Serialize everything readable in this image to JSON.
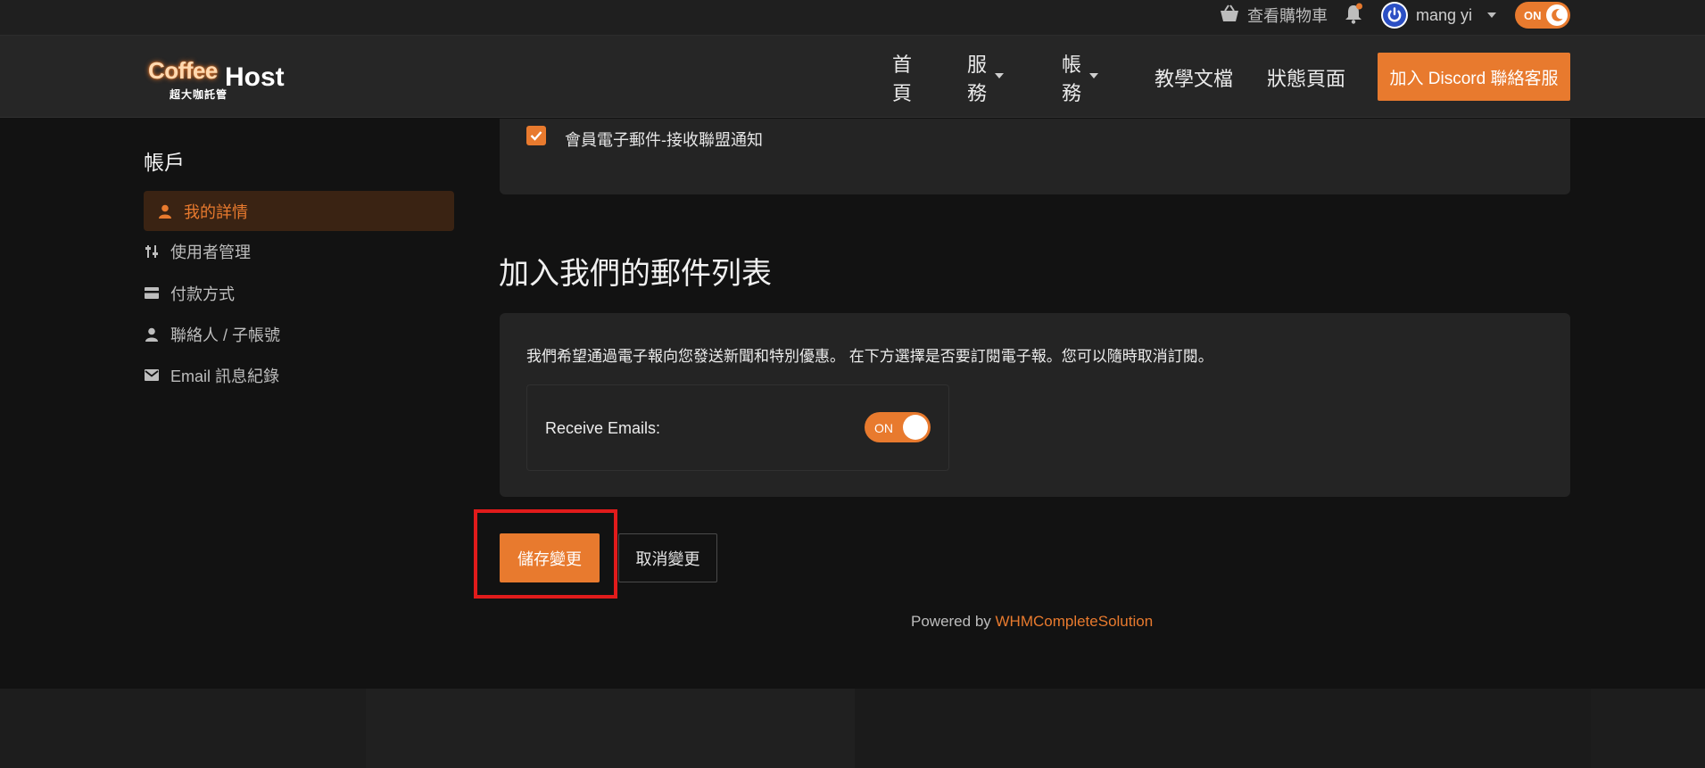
{
  "colors": {
    "accent": "#e87a2e",
    "page_bg": "#121212",
    "card_bg": "#242424",
    "highlight_box": "#e11b1b"
  },
  "topbar": {
    "cart_label": "查看購物車",
    "cart_icon": "basket-icon",
    "bell_icon": "bell-icon",
    "username": "mang yi",
    "theme_toggle_label": "ON",
    "theme_toggle_icon": "moon-icon"
  },
  "navbar": {
    "logo_primary": "Coffee",
    "logo_secondary": "Host",
    "logo_sub": "超大咖託管",
    "links": [
      {
        "label": "首頁",
        "has_dropdown": false
      },
      {
        "label": "服務",
        "has_dropdown": true
      },
      {
        "label": "帳務",
        "has_dropdown": true
      },
      {
        "label": "教學文檔",
        "has_dropdown": false
      },
      {
        "label": "狀態頁面",
        "has_dropdown": false
      }
    ],
    "discord_button": "加入 Discord 聯絡客服"
  },
  "sidebar": {
    "title": "帳戶",
    "items": [
      {
        "label": "我的詳情",
        "icon": "user-icon",
        "active": true
      },
      {
        "label": "使用者管理",
        "icon": "sliders-icon",
        "active": false
      },
      {
        "label": "付款方式",
        "icon": "credit-card-icon",
        "active": false
      },
      {
        "label": "聯絡人 / 子帳號",
        "icon": "user-icon",
        "active": false
      },
      {
        "label": "Email 訊息紀錄",
        "icon": "envelope-icon",
        "active": false
      }
    ]
  },
  "main": {
    "affiliate_checkbox": {
      "label": "會員電子郵件-接收聯盟通知",
      "checked": true
    },
    "mailing_list": {
      "heading": "加入我們的郵件列表",
      "description": "我們希望通過電子報向您發送新聞和特別優惠。 在下方選擇是否要訂閱電子報。您可以隨時取消訂閱。",
      "receive_label": "Receive Emails:",
      "toggle_label": "ON",
      "toggle_on": true
    },
    "actions": {
      "save": "儲存變更",
      "cancel": "取消變更"
    },
    "powered_by_prefix": "Powered by ",
    "powered_by_link": "WHMCompleteSolution"
  }
}
